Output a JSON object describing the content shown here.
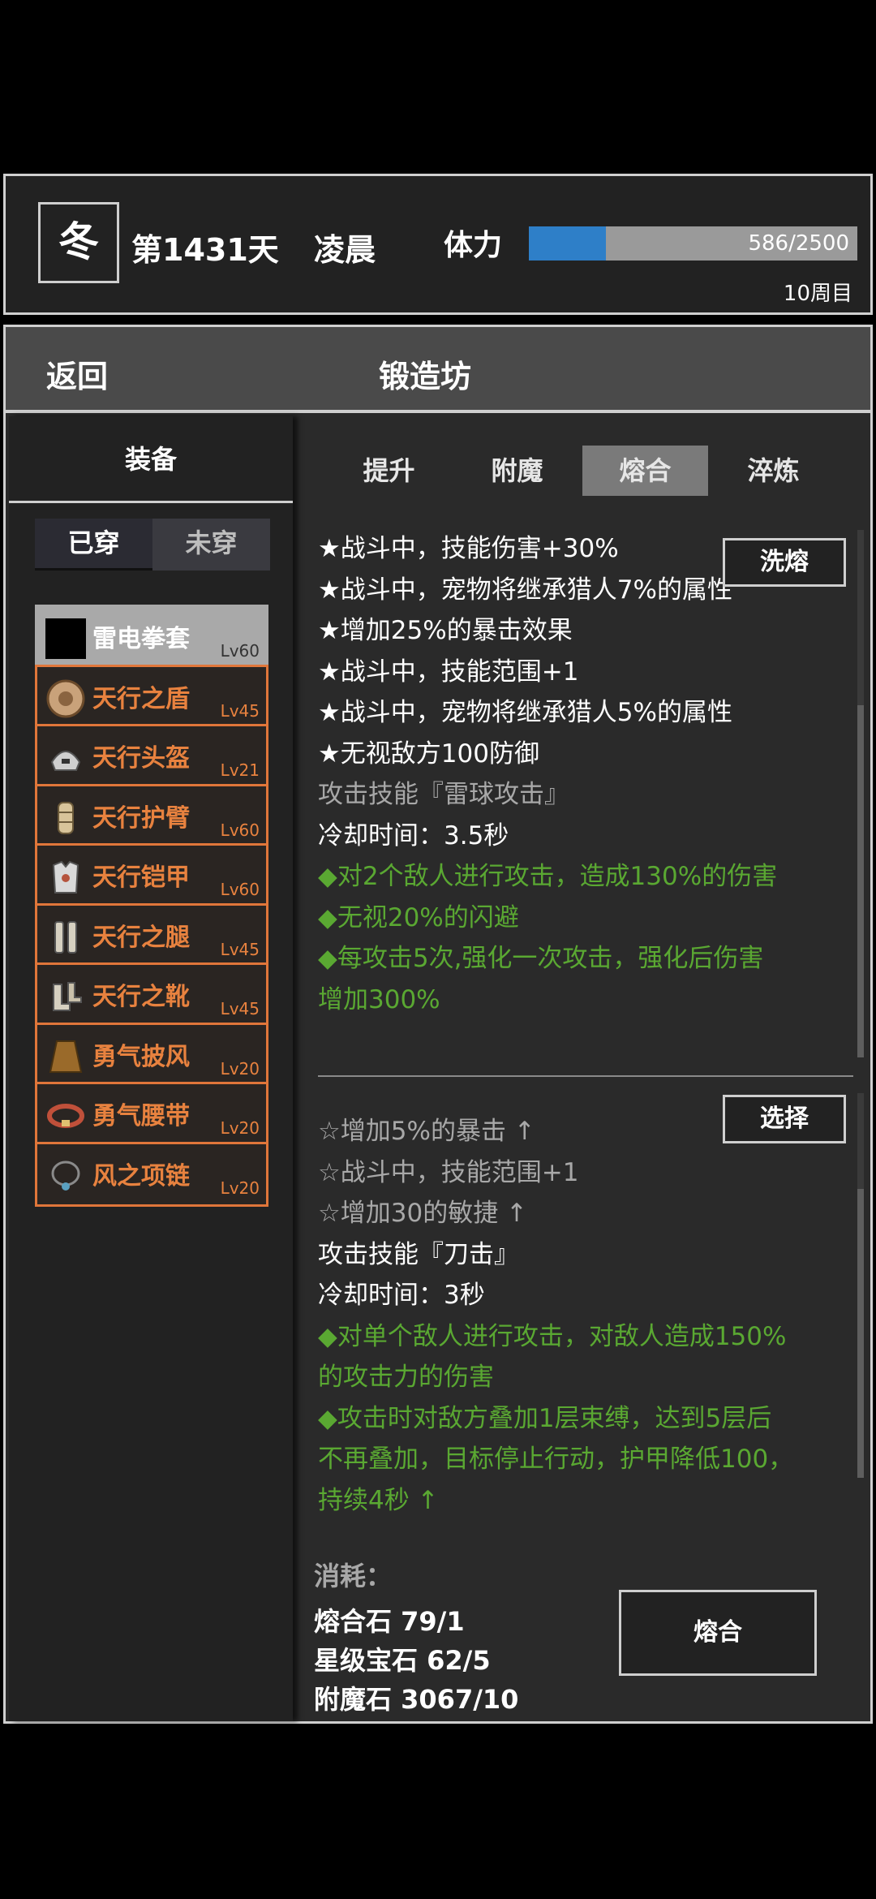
{
  "status": {
    "season": "冬",
    "day": "第1431天",
    "time_of_day": "凌晨",
    "stamina_label": "体力",
    "stamina_text": "586/2500",
    "stamina_fraction": 0.234,
    "cycle": "10周目"
  },
  "titlebar": {
    "back_label": "返回",
    "title": "锻造坊"
  },
  "sidebar": {
    "header": "装备",
    "tabs": {
      "worn": "已穿",
      "unworn": "未穿"
    },
    "items": [
      {
        "name": "雷电拳套",
        "level": "Lv60",
        "icon": "black-square-icon",
        "selected": true
      },
      {
        "name": "天行之盾",
        "level": "Lv45",
        "icon": "shield-icon"
      },
      {
        "name": "天行头盔",
        "level": "Lv21",
        "icon": "helmet-icon"
      },
      {
        "name": "天行护臂",
        "level": "Lv60",
        "icon": "bracer-icon"
      },
      {
        "name": "天行铠甲",
        "level": "Lv60",
        "icon": "armor-icon"
      },
      {
        "name": "天行之腿",
        "level": "Lv45",
        "icon": "leg-armor-icon"
      },
      {
        "name": "天行之靴",
        "level": "Lv45",
        "icon": "boots-icon"
      },
      {
        "name": "勇气披风",
        "level": "Lv20",
        "icon": "cape-icon"
      },
      {
        "name": "勇气腰带",
        "level": "Lv20",
        "icon": "belt-icon"
      },
      {
        "name": "风之项链",
        "level": "Lv20",
        "icon": "necklace-icon"
      }
    ]
  },
  "tabs": [
    "提升",
    "附魔",
    "熔合",
    "淬炼"
  ],
  "active_tab": "熔合",
  "current": {
    "button": "洗熔",
    "lines": [
      {
        "text": "★战斗中，技能伤害+30%",
        "color": "white"
      },
      {
        "text": "★战斗中，宠物将继承猎人7%的属性",
        "color": "white"
      },
      {
        "text": "★增加25%的暴击效果",
        "color": "white"
      },
      {
        "text": "★战斗中，技能范围+1",
        "color": "white"
      },
      {
        "text": "★战斗中，宠物将继承猎人5%的属性",
        "color": "white"
      },
      {
        "text": "★无视敌方100防御",
        "color": "white"
      },
      {
        "text": "攻击技能『雷球攻击』",
        "color": "gray"
      },
      {
        "text": "冷却时间：3.5秒",
        "color": "white"
      },
      {
        "text": "◆对2个敌人进行攻击，造成130%的伤害",
        "color": "green"
      },
      {
        "text": "◆无视20%的闪避",
        "color": "green"
      },
      {
        "text": "◆每攻击5次,强化一次攻击，强化后伤害",
        "color": "green"
      },
      {
        "text": "增加300%",
        "color": "green"
      }
    ]
  },
  "candidate": {
    "button": "选择",
    "lines": [
      {
        "text": "☆增加5%的暴击 ↑",
        "color": "gray"
      },
      {
        "text": "☆战斗中，技能范围+1",
        "color": "gray"
      },
      {
        "text": "☆增加30的敏捷 ↑",
        "color": "gray"
      },
      {
        "text": "攻击技能『刀击』",
        "color": "white"
      },
      {
        "text": "冷却时间：3秒",
        "color": "white"
      },
      {
        "text": "◆对单个敌人进行攻击，对敌人造成150%",
        "color": "green"
      },
      {
        "text": "的攻击力的伤害",
        "color": "green"
      },
      {
        "text": "◆攻击时对敌方叠加1层束缚，达到5层后",
        "color": "green"
      },
      {
        "text": "不再叠加，目标停止行动，护甲降低100，",
        "color": "green"
      },
      {
        "text": "持续4秒 ↑",
        "color": "green"
      }
    ]
  },
  "cost": {
    "label": "消耗：",
    "items": [
      "熔合石 79/1",
      "星级宝石 62/5",
      "附魔石 3067/10"
    ],
    "button": "熔合"
  }
}
